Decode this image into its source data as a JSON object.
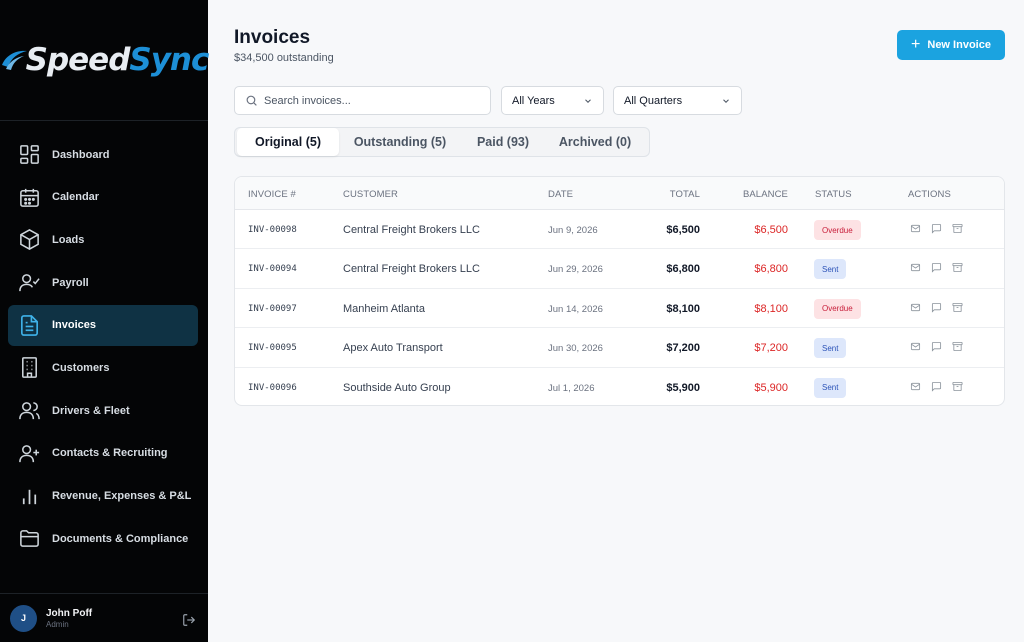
{
  "brand": {
    "part1": "Speed",
    "part2": "Sync",
    "accent": "#1d8fd6"
  },
  "sidebar": {
    "items": [
      {
        "label": "Dashboard",
        "icon": "dashboard-icon"
      },
      {
        "label": "Calendar",
        "icon": "calendar-icon"
      },
      {
        "label": "Loads",
        "icon": "box-icon"
      },
      {
        "label": "Payroll",
        "icon": "user-check-icon"
      },
      {
        "label": "Invoices",
        "icon": "file-text-icon",
        "active": true
      },
      {
        "label": "Customers",
        "icon": "building-icon"
      },
      {
        "label": "Drivers & Fleet",
        "icon": "users-icon"
      },
      {
        "label": "Contacts & Recruiting",
        "icon": "user-plus-icon"
      },
      {
        "label": "Revenue, Expenses & P&L",
        "icon": "bar-chart-icon"
      },
      {
        "label": "Documents & Compliance",
        "icon": "folder-icon"
      }
    ],
    "user": {
      "initial": "J",
      "name": "John Poff",
      "role": "Admin"
    }
  },
  "header": {
    "title": "Invoices",
    "subtitle": "$34,500 outstanding",
    "new_button": "New Invoice"
  },
  "filters": {
    "search_placeholder": "Search invoices...",
    "year": "All Years",
    "quarter": "All Quarters"
  },
  "tabs": [
    {
      "label": "Original (5)",
      "active": true
    },
    {
      "label": "Outstanding (5)"
    },
    {
      "label": "Paid (93)"
    },
    {
      "label": "Archived (0)"
    }
  ],
  "table": {
    "columns": {
      "invoice": "INVOICE #",
      "customer": "CUSTOMER",
      "date": "DATE",
      "total": "TOTAL",
      "balance": "BALANCE",
      "status": "STATUS",
      "actions": "ACTIONS"
    },
    "rows": [
      {
        "invoice": "INV-00098",
        "customer": "Central Freight Brokers LLC",
        "date": "Jun 9, 2026",
        "total": "$6,500",
        "balance": "$6,500",
        "status": "Overdue"
      },
      {
        "invoice": "INV-00094",
        "customer": "Central Freight Brokers LLC",
        "date": "Jun 29, 2026",
        "total": "$6,800",
        "balance": "$6,800",
        "status": "Sent"
      },
      {
        "invoice": "INV-00097",
        "customer": "Manheim Atlanta",
        "date": "Jun 14, 2026",
        "total": "$8,100",
        "balance": "$8,100",
        "status": "Overdue"
      },
      {
        "invoice": "INV-00095",
        "customer": "Apex Auto Transport",
        "date": "Jun 30, 2026",
        "total": "$7,200",
        "balance": "$7,200",
        "status": "Sent"
      },
      {
        "invoice": "INV-00096",
        "customer": "Southside Auto Group",
        "date": "Jul 1, 2026",
        "total": "$5,900",
        "balance": "$5,900",
        "status": "Sent"
      }
    ]
  },
  "colors": {
    "primary": "#1ba3e0",
    "overdue": "#c81e3a",
    "sent": "#2c53b8",
    "balance": "#dc2626"
  }
}
